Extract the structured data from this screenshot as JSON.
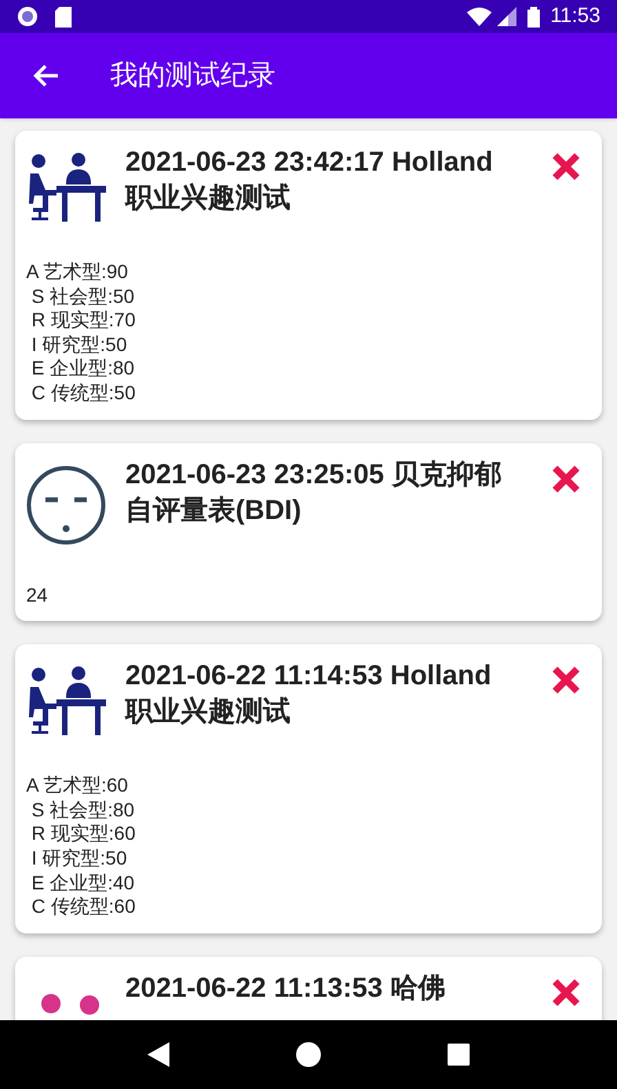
{
  "status_bar": {
    "time": "11:53"
  },
  "app_bar": {
    "title": "我的测试纪录"
  },
  "records": [
    {
      "kind": "interview",
      "title": "2021-06-23 23:42:17 Holland 职业兴趣测试",
      "lines": [
        "A 艺术型:90",
        " S 社会型:50",
        " R 现实型:70",
        " I 研究型:50",
        " E 企业型:80",
        " C 传统型:50"
      ]
    },
    {
      "kind": "face",
      "title": "2021-06-23 23:25:05 贝克抑郁自评量表(BDI)",
      "lines": [
        "24"
      ]
    },
    {
      "kind": "interview",
      "title": "2021-06-22 11:14:53 Holland 职业兴趣测试",
      "lines": [
        "A 艺术型:60",
        " S 社会型:80",
        " R 现实型:60",
        " I 研究型:50",
        " E 企业型:40",
        " C 传统型:60"
      ]
    },
    {
      "kind": "dots",
      "title": "2021-06-22 11:13:53 哈佛"
    }
  ]
}
